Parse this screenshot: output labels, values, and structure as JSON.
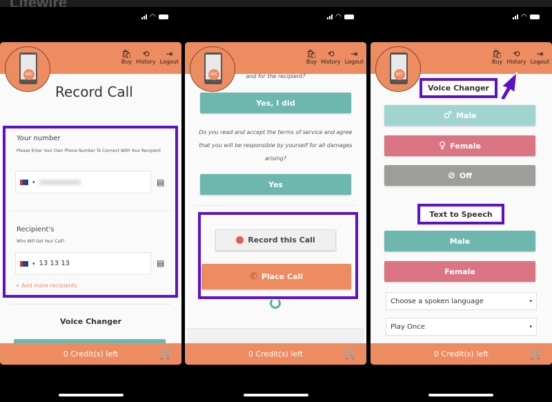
{
  "background_site": {
    "logo": "Lifewire"
  },
  "header": {
    "buy": "Buy",
    "history": "History",
    "logout": "Logout",
    "avatar_badge": "REC"
  },
  "footer": {
    "credits": "0 Credit(s) left"
  },
  "screen1": {
    "title": "Record Call",
    "your_number_label": "Your number",
    "your_number_hint": "Please Enter Your Own Phone Number To Connect With Your Recipient",
    "your_number_value": "",
    "recipient_label": "Recipient's",
    "recipient_hint": "Who Will Get Your Call?",
    "recipient_value": "13 13 13",
    "add_more": "+ Add more recipients",
    "voice_changer": "Voice Changer"
  },
  "screen2": {
    "question1_tail": "and for the recipient?",
    "yes_did": "Yes, I did",
    "question2": "Do you read and accept the terms of service and agree that you will be responsible by yourself for all damages arising?",
    "yes": "Yes",
    "record_call": "Record this Call",
    "place_call": "Place Call"
  },
  "screen3": {
    "voice_changer": "Voice Changer",
    "vc_male": "Male",
    "vc_female": "Female",
    "vc_off": "Off",
    "tts": "Text to Speech",
    "tts_male": "Male",
    "tts_female": "Female",
    "language_select": "Choose a spoken language",
    "play_select": "Play Once"
  },
  "colors": {
    "brand": "#ec8c60",
    "teal": "#6db7ae",
    "pink": "#dc7583",
    "highlight": "#5b10c9"
  }
}
